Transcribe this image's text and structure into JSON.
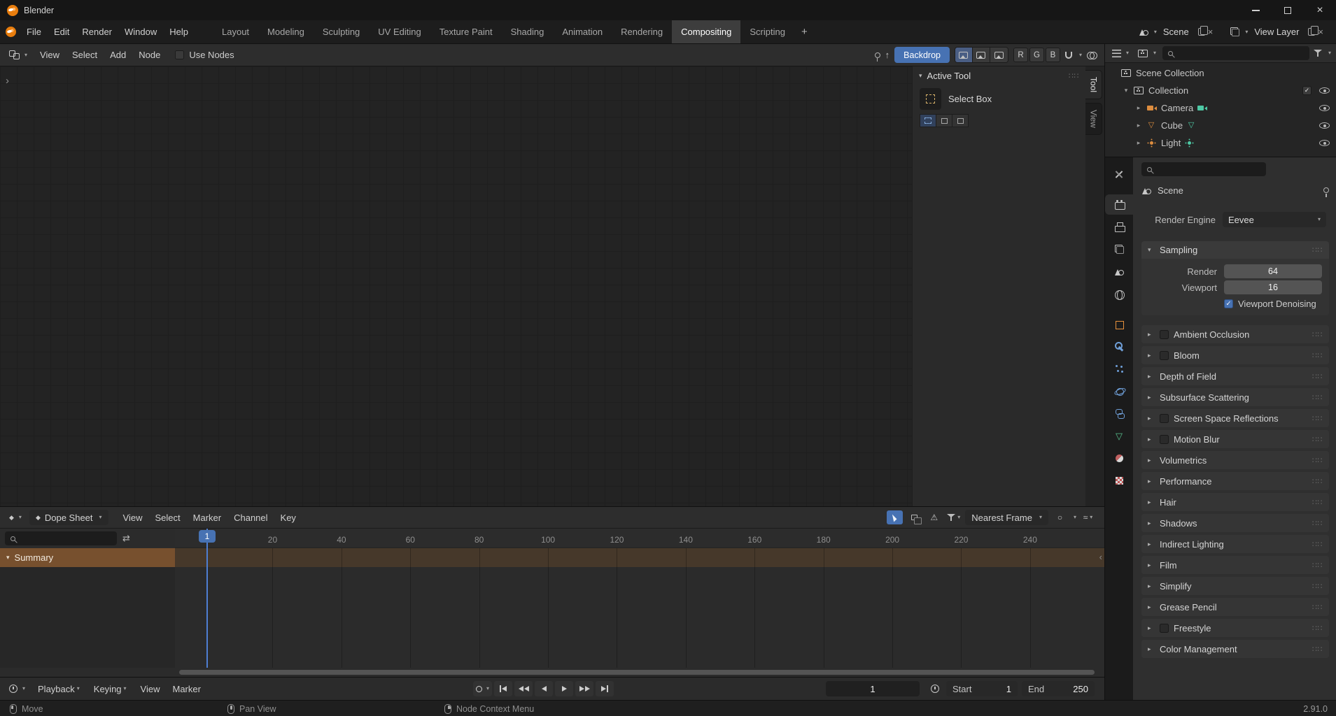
{
  "window": {
    "title": "Blender"
  },
  "topbar": {
    "menus": [
      "File",
      "Edit",
      "Render",
      "Window",
      "Help"
    ],
    "workspaces": [
      "Layout",
      "Modeling",
      "Sculpting",
      "UV Editing",
      "Texture Paint",
      "Shading",
      "Animation",
      "Rendering",
      "Compositing",
      "Scripting"
    ],
    "active_workspace": "Compositing",
    "new_workspace": "+",
    "scene": "Scene",
    "view_layer": "View Layer"
  },
  "compositor": {
    "menus": [
      "View",
      "Select",
      "Add",
      "Node"
    ],
    "use_nodes": "Use Nodes",
    "backdrop": "Backdrop",
    "channels": [
      "R",
      "G",
      "B"
    ],
    "tool_panel": {
      "title": "Active Tool",
      "tool": "Select Box"
    },
    "tabs": [
      "Tool",
      "View"
    ],
    "active_tab": "Tool"
  },
  "outliner": {
    "rows": [
      {
        "label": "Scene Collection",
        "icon": "scene-collection",
        "indent": 0
      },
      {
        "label": "Collection",
        "icon": "collection",
        "indent": 1,
        "expanded": true,
        "checkbox": true,
        "eye": true
      },
      {
        "label": "Camera",
        "icon": "camera",
        "data_icon": "camera-data",
        "indent": 2,
        "eye": true
      },
      {
        "label": "Cube",
        "icon": "mesh",
        "data_icon": "mesh-data",
        "indent": 2,
        "eye": true
      },
      {
        "label": "Light",
        "icon": "light",
        "data_icon": "light-data",
        "indent": 2,
        "eye": true
      }
    ]
  },
  "properties": {
    "tabs": [
      "tool",
      "render",
      "output",
      "view-layer",
      "scene",
      "world",
      "object",
      "modifiers",
      "particles",
      "physics",
      "constraints",
      "object-data",
      "material",
      "texture"
    ],
    "active_tab": "render",
    "breadcrumb": "Scene",
    "render_engine": {
      "label": "Render Engine",
      "value": "Eevee"
    },
    "sampling": {
      "title": "Sampling",
      "render": {
        "label": "Render",
        "value": "64"
      },
      "viewport": {
        "label": "Viewport",
        "value": "16"
      },
      "denoising": {
        "label": "Viewport Denoising",
        "checked": true
      }
    },
    "sections": [
      {
        "label": "Ambient Occlusion",
        "checkbox": true
      },
      {
        "label": "Bloom",
        "checkbox": true
      },
      {
        "label": "Depth of Field"
      },
      {
        "label": "Subsurface Scattering"
      },
      {
        "label": "Screen Space Reflections",
        "checkbox": true
      },
      {
        "label": "Motion Blur",
        "checkbox": true
      },
      {
        "label": "Volumetrics"
      },
      {
        "label": "Performance"
      },
      {
        "label": "Hair"
      },
      {
        "label": "Shadows"
      },
      {
        "label": "Indirect Lighting"
      },
      {
        "label": "Film"
      },
      {
        "label": "Simplify"
      },
      {
        "label": "Grease Pencil"
      },
      {
        "label": "Freestyle",
        "checkbox": true
      },
      {
        "label": "Color Management"
      }
    ]
  },
  "dopesheet": {
    "editor": "Dope Sheet",
    "menus": [
      "View",
      "Select",
      "Marker",
      "Channel",
      "Key"
    ],
    "snap": "Nearest Frame",
    "summary": "Summary",
    "current_frame": "1",
    "frame_labels": [
      20,
      40,
      60,
      80,
      100,
      120,
      140,
      160,
      180,
      200,
      220,
      240
    ]
  },
  "timeline": {
    "playback": "Playback",
    "keying": "Keying",
    "menus": [
      "View",
      "Marker"
    ],
    "transport": [
      "jump-start",
      "prev-keyframe",
      "play-reverse",
      "play",
      "next-keyframe",
      "jump-end"
    ],
    "frame": "1",
    "start": {
      "label": "Start",
      "value": "1"
    },
    "end": {
      "label": "End",
      "value": "250"
    }
  },
  "statusbar": {
    "hints": [
      {
        "mouse": "left",
        "label": "Move"
      },
      {
        "mouse": "middle",
        "label": "Pan View"
      },
      {
        "mouse": "right",
        "label": "Node Context Menu"
      }
    ],
    "version": "2.91.0"
  }
}
